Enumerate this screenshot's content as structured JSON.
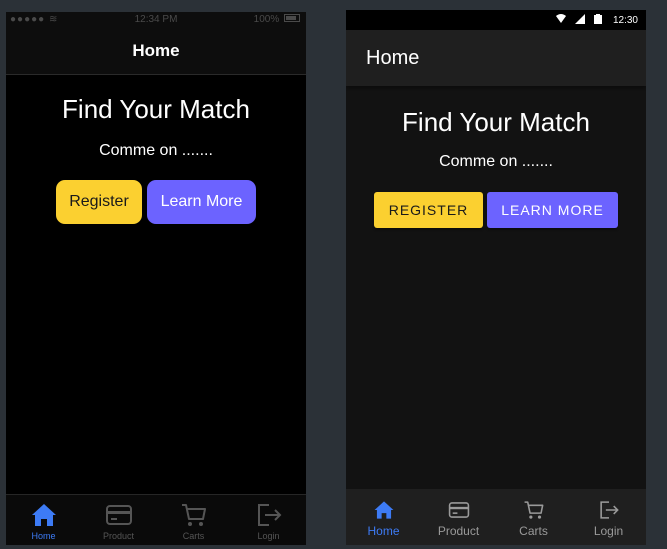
{
  "ios": {
    "status": {
      "signal": "●●●●● ≋",
      "time": "12:34 PM",
      "battery": "100%"
    },
    "header_title": "Home",
    "title": "Find Your Match",
    "subtitle": "Comme on .......",
    "register_label": "Register",
    "learn_more_label": "Learn More",
    "tabs": [
      {
        "label": "Home",
        "icon": "home-icon",
        "active": true
      },
      {
        "label": "Product",
        "icon": "card-icon",
        "active": false
      },
      {
        "label": "Carts",
        "icon": "cart-icon",
        "active": false
      },
      {
        "label": "Login",
        "icon": "login-icon",
        "active": false
      }
    ]
  },
  "android": {
    "status": {
      "time": "12:30"
    },
    "appbar_title": "Home",
    "title": "Find Your Match",
    "subtitle": "Comme on .......",
    "register_label": "REGISTER",
    "learn_more_label": "LEARN MORE",
    "tabs": [
      {
        "label": "Home",
        "icon": "home-icon",
        "active": true
      },
      {
        "label": "Product",
        "icon": "card-icon",
        "active": false
      },
      {
        "label": "Carts",
        "icon": "cart-icon",
        "active": false
      },
      {
        "label": "Login",
        "icon": "login-icon",
        "active": false
      }
    ]
  },
  "colors": {
    "background": "#2b3137",
    "register": "#fbd030",
    "learn_more": "#6c63ff",
    "active_tab": "#3d7bf5"
  }
}
